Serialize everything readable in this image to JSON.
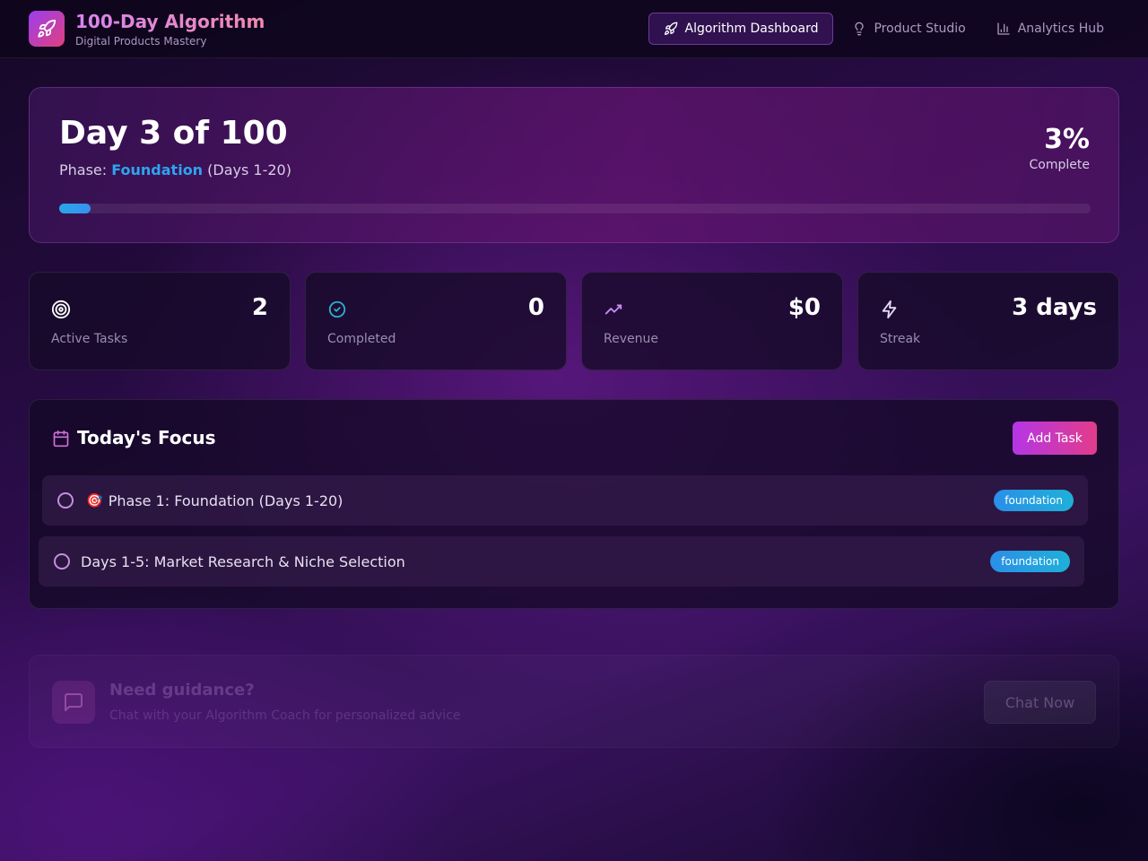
{
  "header": {
    "brand_title": "100-Day Algorithm",
    "brand_subtitle": "Digital Products Mastery",
    "nav": [
      {
        "label": "Algorithm Dashboard",
        "icon": "rocket-icon",
        "active": true
      },
      {
        "label": "Product Studio",
        "icon": "lightbulb-icon",
        "active": false
      },
      {
        "label": "Analytics Hub",
        "icon": "bar-chart-icon",
        "active": false
      }
    ]
  },
  "progress": {
    "title": "Day 3 of 100",
    "phase_prefix": "Phase: ",
    "phase_name": "Foundation",
    "phase_range": " (Days 1-20)",
    "percent_label": "3%",
    "percent_value": 3,
    "complete_label": "Complete"
  },
  "stats": [
    {
      "icon": "target-icon",
      "value": "2",
      "label": "Active Tasks",
      "color": "#ffffff"
    },
    {
      "icon": "check-circle-icon",
      "value": "0",
      "label": "Completed",
      "color": "#2bb0c8"
    },
    {
      "icon": "trending-up-icon",
      "value": "$0",
      "label": "Revenue",
      "color": "#c78cf0"
    },
    {
      "icon": "lightning-icon",
      "value": "3 days",
      "label": "Streak",
      "color": "#e6d8f5"
    }
  ],
  "focus": {
    "title": "Today's Focus",
    "add_label": "Add Task",
    "tasks": [
      {
        "emoji": "🎯",
        "text": "Phase 1: Foundation (Days 1-20)",
        "badge": "foundation"
      },
      {
        "emoji": "",
        "text": "Days 1-5: Market Research & Niche Selection",
        "badge": "foundation"
      }
    ]
  },
  "guidance": {
    "title": "Need guidance?",
    "subtitle": "Chat with your Algorithm Coach for personalized advice",
    "button_label": "Chat Now"
  },
  "colors": {
    "accent_pink": "#e23c8a",
    "accent_purple": "#b536e6",
    "phase_blue": "#2ea4f0"
  }
}
